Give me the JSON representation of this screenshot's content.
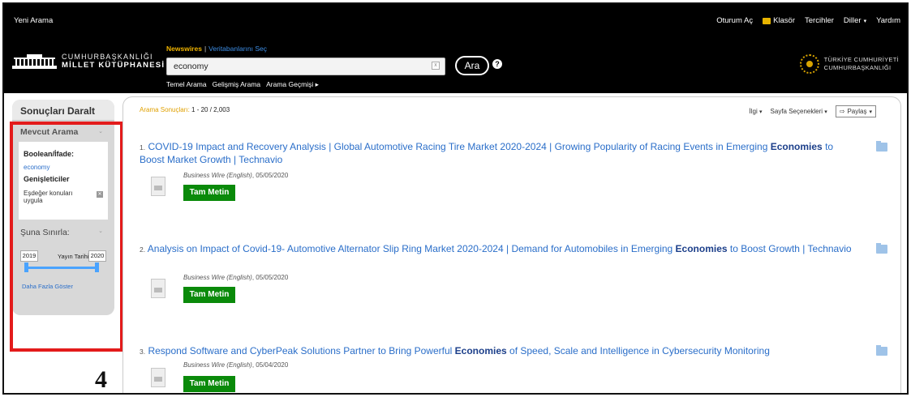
{
  "topbar": {
    "new_search": "Yeni Arama",
    "nav": [
      "Oturum Aç",
      "Klasör",
      "Tercihler",
      "Diller",
      "Yardım"
    ]
  },
  "header": {
    "logo_left_line1": "CUMHURBAŞKANLIĞI",
    "logo_left_line2": "MİLLET KÜTÜPHANESİ",
    "source_label": "Newswires",
    "source_separator": "|",
    "choose_databases": "Veritabanlarını Seç",
    "search_value": "economy",
    "search_button": "Ara",
    "help": "?",
    "sub_links": [
      "Temel Arama",
      "Gelişmiş Arama",
      "Arama Geçmişi ▸"
    ],
    "logo_right_line1": "TÜRKİYE CUMHURİYETİ",
    "logo_right_line2": "CUMHURBAŞKANLIĞI"
  },
  "sidebar": {
    "title": "Sonuçları Daralt",
    "current_search_head": "Mevcut Arama",
    "boolean_label": "Boolean/İfade:",
    "boolean_value": "economy",
    "expanders_label": "Genişleticiler",
    "expander_option": "Eşdeğer konuları uygula",
    "limit_head": "Şuna Sınırla:",
    "year_from": "2019",
    "year_label": "Yayın Tarihi",
    "year_to": "2020",
    "show_more": "Daha Fazla Göster"
  },
  "annotation": {
    "number": "4",
    "highlight_color": "#e31b1b"
  },
  "results": {
    "count_label": "Arama Sonuçları:",
    "count_value": "1 - 20 / 2,003",
    "toolbar": {
      "relevance": "İlgi",
      "page_options": "Sayfa Seçenekleri",
      "share": "Paylaş"
    },
    "items": [
      {
        "num": "1.",
        "title_before": "COVID-19 Impact and Recovery Analysis | Global Automotive Racing Tire Market 2020-2024 | Growing Popularity of Racing Events in Emerging ",
        "title_bold": "Economies",
        "title_after": " to Boost Market Growth | Technavio",
        "source": "Business Wire (English)",
        "date": ", 05/05/2020",
        "button": "Tam Metin"
      },
      {
        "num": "2.",
        "title_before": "Analysis on Impact of Covid-19- Automotive Alternator Slip Ring Market 2020-2024 | Demand for Automobiles in Emerging ",
        "title_bold": "Economies",
        "title_after": " to Boost Growth | Technavio",
        "source": "Business Wire (English)",
        "date": ", 05/05/2020",
        "button": "Tam Metin"
      },
      {
        "num": "3.",
        "title_before": "Respond Software and CyberPeak Solutions Partner to Bring Powerful ",
        "title_bold": "Economies",
        "title_after": " of Speed, Scale and Intelligence in Cybersecurity Monitoring",
        "source": "Business Wire (English)",
        "date": ", 05/04/2020",
        "button": "Tam Metin"
      }
    ]
  }
}
